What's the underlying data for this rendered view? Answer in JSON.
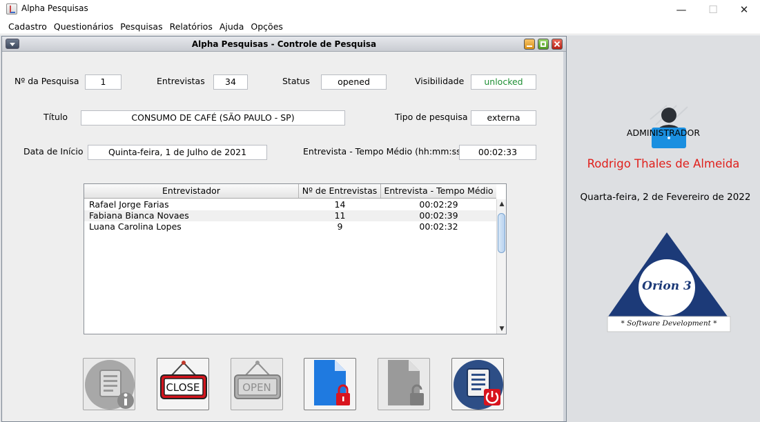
{
  "app": {
    "title": "Alpha Pesquisas"
  },
  "window_controls": {
    "minimize": "—",
    "maximize": "☐",
    "close": "✕"
  },
  "menu": [
    "Cadastro",
    "Questionários",
    "Pesquisas",
    "Relatórios",
    "Ajuda",
    "Opções"
  ],
  "frame": {
    "title": "Alpha Pesquisas - Controle de Pesquisa"
  },
  "form": {
    "numero_label": "Nº da Pesquisa",
    "numero_value": "1",
    "entrevistas_label": "Entrevistas",
    "entrevistas_value": "34",
    "status_label": "Status",
    "status_value": "opened",
    "visibilidade_label": "Visibilidade",
    "visibilidade_value": "unlocked",
    "titulo_label": "Título",
    "titulo_value": "CONSUMO DE CAFÉ (SÃO PAULO - SP)",
    "tipo_label": "Tipo de pesquisa",
    "tipo_value": "externa",
    "data_label": "Data de Início",
    "data_value": "Quinta-feira, 1 de Julho de 2021",
    "tempo_label": "Entrevista - Tempo Médio (hh:mm:ss)",
    "tempo_value": "00:02:33"
  },
  "table": {
    "columns": [
      "Entrevistador",
      "Nº de Entrevistas",
      "Entrevista - Tempo Médio"
    ],
    "rows": [
      [
        "Rafael Jorge Farias",
        "14",
        "00:02:29"
      ],
      [
        "Fabiana Bianca Novaes",
        "11",
        "00:02:39"
      ],
      [
        "Luana Carolina Lopes",
        "9",
        "00:02:32"
      ]
    ]
  },
  "buttons": {
    "close_sign": "CLOSE",
    "open_sign": "OPEN"
  },
  "user": {
    "role": "ADMINISTRADOR",
    "name": "Rodrigo Thales de Almeida",
    "date": "Quarta-feira, 2 de Fevereiro de 2022"
  },
  "logo": {
    "name": "Orion 3",
    "tagline": "* Software Development *"
  },
  "colors": {
    "user_name": "#e0201c",
    "visibility_text": "#1d8f33",
    "logo_triangle": "#1c3a78",
    "document_blue": "#1f7ae0",
    "lock_red": "#d8141e",
    "power_circle": "#2d4e86"
  }
}
